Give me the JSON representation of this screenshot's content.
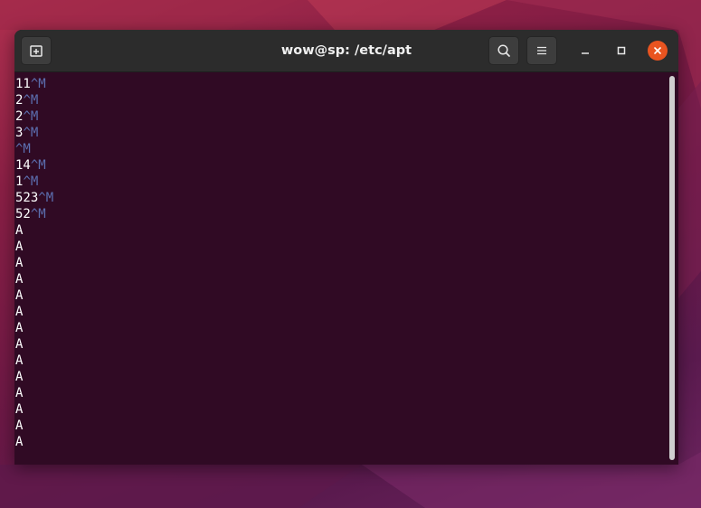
{
  "window": {
    "title": "wow@sp: /etc/apt"
  },
  "terminal": {
    "lines": [
      {
        "text": "11",
        "ctrl": "^M"
      },
      {
        "text": "2",
        "ctrl": "^M"
      },
      {
        "text": "2",
        "ctrl": "^M"
      },
      {
        "text": "3",
        "ctrl": "^M"
      },
      {
        "text": "",
        "ctrl": "^M"
      },
      {
        "text": "14",
        "ctrl": "^M"
      },
      {
        "text": "1",
        "ctrl": "^M"
      },
      {
        "text": "523",
        "ctrl": "^M"
      },
      {
        "text": "52",
        "ctrl": "^M"
      },
      {
        "text": "A",
        "ctrl": ""
      },
      {
        "text": "A",
        "ctrl": ""
      },
      {
        "text": "A",
        "ctrl": ""
      },
      {
        "text": "A",
        "ctrl": ""
      },
      {
        "text": "A",
        "ctrl": ""
      },
      {
        "text": "A",
        "ctrl": ""
      },
      {
        "text": "A",
        "ctrl": ""
      },
      {
        "text": "A",
        "ctrl": ""
      },
      {
        "text": "A",
        "ctrl": ""
      },
      {
        "text": "A",
        "ctrl": ""
      },
      {
        "text": "A",
        "ctrl": ""
      },
      {
        "text": "A",
        "ctrl": ""
      },
      {
        "text": "A",
        "ctrl": ""
      },
      {
        "text": "A",
        "ctrl": ""
      }
    ]
  },
  "icons": {
    "new_tab": "new-tab-icon",
    "search": "search-icon",
    "menu": "hamburger-menu-icon",
    "minimize": "minimize-icon",
    "maximize": "maximize-icon",
    "close": "close-icon"
  },
  "colors": {
    "terminal_bg": "#300a24",
    "titlebar_bg": "#2c2c2c",
    "control_char": "#5c6fb0",
    "close_button": "#e95420"
  }
}
